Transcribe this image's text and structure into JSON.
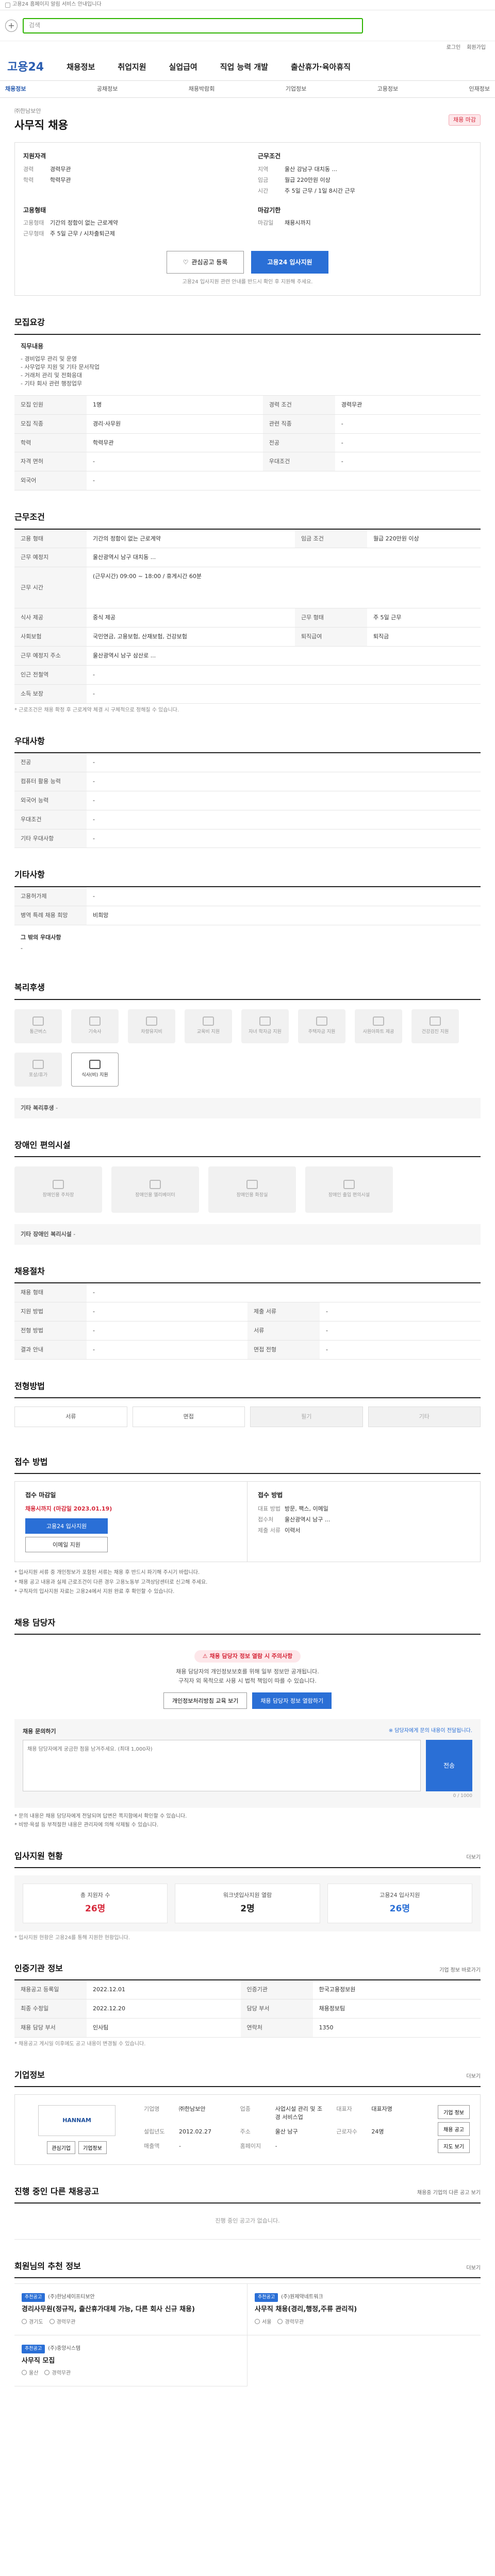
{
  "topbar": {
    "notice": "고용24 홈페이지 알림 서비스 안내입니다"
  },
  "search": {
    "placeholder": "검색"
  },
  "util": [
    "로그인",
    "회원가입"
  ],
  "gnb": {
    "logo": "고용24",
    "items": [
      "채용정보",
      "취업지원",
      "실업급여",
      "직업 능력 개발",
      "출산휴가·육아휴직"
    ]
  },
  "lnb": [
    "채용정보",
    "공채정보",
    "채용박람회",
    "기업정보",
    "고용정보",
    "인재정보"
  ],
  "job": {
    "company": "㈜한남보안",
    "title": "사무직 채용",
    "badge": "채용 마감"
  },
  "summary": {
    "qual_title": "지원자격",
    "qual": [
      [
        "경력",
        "경력무관"
      ],
      [
        "학력",
        "학력무관"
      ]
    ],
    "cond_title": "근무조건",
    "cond": [
      [
        "지역",
        "울산 강남구 대치동 ..."
      ],
      [
        "임금",
        "월급 220만원 이상"
      ],
      [
        "시간",
        "주 5일 근무 / 1일 8시간 근무"
      ]
    ],
    "type_title": "고용형태",
    "type": [
      [
        "고용형태",
        "기간의 정함이 없는 근로계약"
      ],
      [
        "근무형태",
        "주 5일 근무 / 시차출퇴근제"
      ]
    ],
    "deadline_title": "마감기한",
    "deadline": [
      [
        "마감일",
        "채용시까지"
      ]
    ]
  },
  "actions": {
    "scrap": "관심공고 등록",
    "apply": "고용24 입사지원"
  },
  "actions_note": "고용24 입사지원 관련 안내를 반드시 확인 후 지원해 주세요.",
  "sec_qual": {
    "title": "모집요강",
    "dutyLabel": "직무내용",
    "duties": [
      "- 경비업무 관리 및 운영",
      "- 사무업무 지원 및 기타 문서작업",
      "- 거래처 관리 및 전화응대",
      "- 기타 회사 관련 행정업무"
    ],
    "rows": [
      [
        "모집 인원",
        "1명",
        "경력 조건",
        "경력무관"
      ],
      [
        "모집 직종",
        "경리·사무원",
        "관련 직종",
        "-"
      ],
      [
        "학력",
        "학력무관",
        "전공",
        "-"
      ],
      [
        "자격 면허",
        "-",
        "우대조건",
        "-"
      ],
      [
        "외국어",
        "-",
        "",
        ""
      ]
    ]
  },
  "sec_cond": {
    "title": "근무조건",
    "rows": [
      [
        "고용 형태",
        "기간의 정함이 없는 근로계약",
        "임금 조건",
        "월급 220만원 이상"
      ],
      [
        "근무 예정지",
        "울산광역시 남구 대치동 ...",
        "",
        ""
      ],
      [
        "근무 시간",
        "(근무시간) 09:00 ~ 18:00 / 휴게시간 60분",
        "",
        ""
      ],
      [
        "식사 제공",
        "중식 제공",
        "근무 형태",
        "주 5일 근무"
      ],
      [
        "사회보험",
        "국민연금, 고용보험, 산재보험, 건강보험",
        "퇴직급여",
        "퇴직금"
      ],
      [
        "근무 예정지 주소",
        "울산광역시 남구 삼산로 ...",
        "",
        ""
      ],
      [
        "인근 전철역",
        "-",
        "",
        ""
      ],
      [
        "소득 보장",
        "-",
        "",
        ""
      ]
    ],
    "note": "* 근로조건은 채용 확정 후 근로계약 체결 시 구체적으로 정해질 수 있습니다."
  },
  "sec_pref": {
    "title": "우대사항",
    "rows": [
      [
        "전공",
        "-"
      ],
      [
        "컴퓨터 활용 능력",
        "-"
      ],
      [
        "외국어 능력",
        "-"
      ],
      [
        "우대조건",
        "-"
      ],
      [
        "기타 우대사항",
        "-"
      ]
    ]
  },
  "sec_etc": {
    "title": "기타사항",
    "rows": [
      [
        "고용허가제",
        "-"
      ],
      [
        "병역 특례 채용 희망",
        "비희망"
      ]
    ],
    "other_label": "그 밖의 우대사항",
    "other": "-"
  },
  "sec_welfare": {
    "title": "복리후생",
    "tiles": [
      "통근버스",
      "기숙사",
      "차량유지비",
      "교육비 지원",
      "자녀 학자금 지원",
      "주택자금 지원",
      "사원아파트 제공",
      "건강검진 지원",
      "포상/휴가",
      "식사(비) 지원"
    ],
    "active": [
      9
    ],
    "other_label": "기타 복리후생",
    "other": "-"
  },
  "sec_disabled": {
    "title": "장애인 편의시설",
    "tiles": [
      "장애인용 주차장",
      "장애인용 엘리베이터",
      "장애인용 화장실",
      "장애인 출입 편의시설"
    ],
    "other_label": "기타 장애인 복리시설",
    "other": "-"
  },
  "sec_manner": {
    "title": "채용절차",
    "rows": [
      [
        "채용 형태",
        "-",
        "",
        ""
      ],
      [
        "지원 방법",
        "-",
        "제출 서류",
        "-"
      ],
      [
        "전형 방법",
        "-",
        "서류",
        "-"
      ],
      [
        "결과 안내",
        "-",
        "면접 전형",
        "-"
      ]
    ]
  },
  "sec_process": {
    "title": "전형방법",
    "chips": [
      "서류",
      "면접",
      "필기",
      "기타"
    ]
  },
  "sec_apply": {
    "title": "접수 방법",
    "left_title": "접수 마감일",
    "left_red": "채용시까지 (마감일 2023.01.19)",
    "btn_apply": "고용24 입사지원",
    "btn_email": "이메일 지원",
    "right_title": "접수 방법",
    "right_rows": [
      [
        "대표 방법",
        "방문, 팩스, 이메일"
      ],
      [
        "접수처",
        "울산광역시 남구 ..."
      ],
      [
        "제출 서류",
        "이력서"
      ]
    ],
    "bullets": [
      "* 입사지원 서류 중 개인정보가 포함된 서류는 채용 후 반드시 파기해 주시기 바랍니다.",
      "* 채용 공고 내용과 실제 근로조건이 다른 경우 고용노동부 고객상담센터로 신고해 주세요.",
      "* 구직자의 입사지원 자료는 고용24에서 지원 완료 후 확인할 수 있습니다."
    ]
  },
  "sec_contact": {
    "title": "채용 담당자",
    "alert": "채용 담당자 정보 열람 시 주의사항",
    "desc": "채용 담당자의 개인정보보호를 위해 일부 정보만 공개됩니다.",
    "desc2": "구직자 외 목적으로 사용 시 법적 책임이 따를 수 있습니다.",
    "btn1": "개인정보처리방침 교육 보기",
    "btn2": "채용 담당자 정보 열람하기",
    "inquiry_label": "채용 문의하기",
    "inquiry_right": "※ 담당자에게 문의 내용이 전달됩니다.",
    "inquiry_placeholder": "채용 담당자에게 궁금한 점을 남겨주세요. (최대 1,000자)",
    "inquiry_btn": "전송",
    "count": "0 / 1000",
    "notes": [
      "* 문의 내용은 채용 담당자에게 전달되며 답변은 쪽지함에서 확인할 수 있습니다.",
      "* 비방·욕설 등 부적절한 내용은 관리자에 의해 삭제될 수 있습니다."
    ]
  },
  "sec_stats": {
    "title": "입사지원 현황",
    "more": "더보기",
    "items": [
      [
        "총 지원자 수",
        "26명"
      ],
      [
        "워크넷입사지원 열람",
        "2명"
      ],
      [
        "고용24 입사지원",
        "26명"
      ]
    ],
    "note": "* 입사지원 현황은 고용24를 통해 지원한 현황입니다."
  },
  "sec_info": {
    "title": "인증기관 정보",
    "more": "기업 정보 바로가기",
    "rows": [
      [
        "채용공고 등록일",
        "2022.12.01",
        "인증기관",
        "한국고용정보원"
      ],
      [
        "최종 수정일",
        "2022.12.20",
        "담당 부서",
        "채용정보팀"
      ],
      [
        "채용 담당 부서",
        "인사팀",
        "연락처",
        "1350"
      ]
    ],
    "note": "* 채용공고 게시일 이후에도 공고 내용이 변경될 수 있습니다."
  },
  "sec_company": {
    "title": "기업정보",
    "more": "더보기",
    "logo": "HANNAM",
    "btn1": "관심기업",
    "btn2": "기업정보",
    "rows": [
      [
        "기업명",
        "㈜한남보안"
      ],
      [
        "업종",
        "사업시설 관리 및 조경 서비스업"
      ],
      [
        "대표자",
        "대표자명"
      ],
      [
        "설립년도",
        "2012.02.27"
      ],
      [
        "주소",
        "울산 남구"
      ],
      [
        "근로자수",
        "24명"
      ],
      [
        "매출액",
        "-"
      ],
      [
        "홈페이지",
        "-"
      ],
      [
        "",
        ""
      ]
    ],
    "side": [
      "기업 정보",
      "채용 공고",
      "지도 보기"
    ]
  },
  "sec_other": {
    "title": "진행 중인 다른 채용공고",
    "more": "채용중 기업의 다른 공고 보기",
    "empty": "진행 중인 공고가 없습니다."
  },
  "sec_reco": {
    "title": "회원님의 추천 정보",
    "more": "더보기",
    "cards": [
      {
        "tag": "추천공고",
        "company": "(주)한남세이프티보안",
        "title": "경리사무원(정규직, 출산휴가대체 가능, 다른 회사 신규 채용)",
        "loc": "경기도",
        "career": "경력무관"
      },
      {
        "tag": "추천공고",
        "company": "(주)원제약네트워크",
        "title": "사무직 채용(경리,행정,주류 관리직)",
        "loc": "서울",
        "career": "경력무관"
      },
      {
        "tag": "추천공고",
        "company": "(주)중앙시스템",
        "title": "사무직 모집",
        "loc": "울산",
        "career": "경력무관"
      }
    ]
  }
}
